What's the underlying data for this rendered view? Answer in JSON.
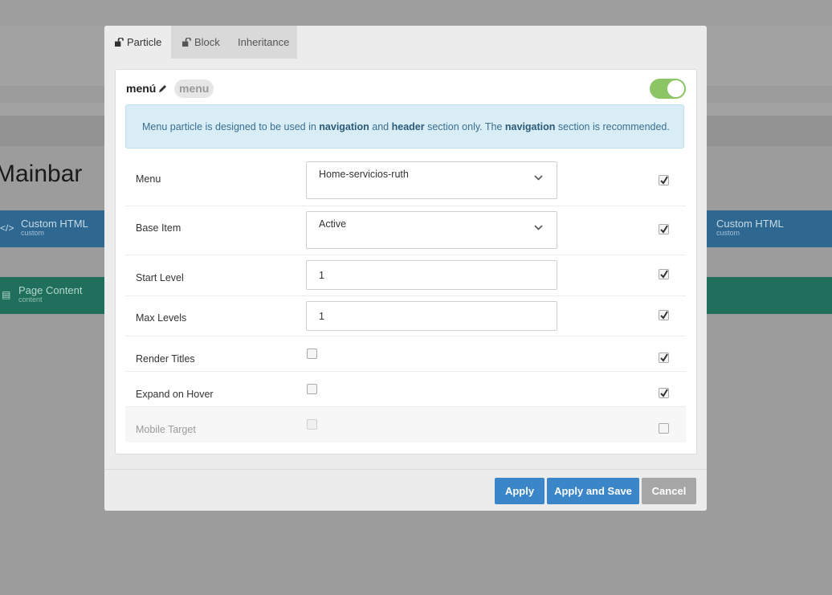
{
  "background": {
    "title": "Mainbar",
    "blocks": [
      {
        "name": "Custom HTML",
        "sub": "custom",
        "color": "#2e6891"
      },
      {
        "name": "Custom HTML",
        "sub": "custom",
        "color": "#2e6891"
      },
      {
        "name": "Page Content",
        "sub": "content",
        "color": "#1f6f5c"
      }
    ]
  },
  "modal": {
    "tabs": [
      {
        "label": "Particle"
      },
      {
        "label": "Block"
      },
      {
        "label": "Inheritance"
      }
    ],
    "particle_title": "menú",
    "particle_badge": "menu",
    "enabled": true,
    "info": {
      "pre": "Menu particle is designed to be used in ",
      "b1": "navigation",
      "mid1": " and ",
      "b2": "header",
      "mid2": " section only. The ",
      "b3": "navigation",
      "post": " section is recommended."
    },
    "fields": [
      {
        "label": "Menu",
        "type": "select",
        "value": "Home-servicios-ruth",
        "override": true
      },
      {
        "label": "Base Item",
        "type": "select",
        "value": "Active",
        "override": true
      },
      {
        "label": "Start Level",
        "type": "input",
        "value": "1",
        "override": true
      },
      {
        "label": "Max Levels",
        "type": "input",
        "value": "1",
        "override": true
      },
      {
        "label": "Render Titles",
        "type": "checkbox",
        "checked": false,
        "override": true
      },
      {
        "label": "Expand on Hover",
        "type": "checkbox",
        "checked": false,
        "override": true
      },
      {
        "label": "Mobile Target",
        "type": "checkbox",
        "checked": false,
        "override": false,
        "disabled": true
      }
    ],
    "buttons": {
      "apply": "Apply",
      "apply_save": "Apply and Save",
      "cancel": "Cancel"
    }
  }
}
